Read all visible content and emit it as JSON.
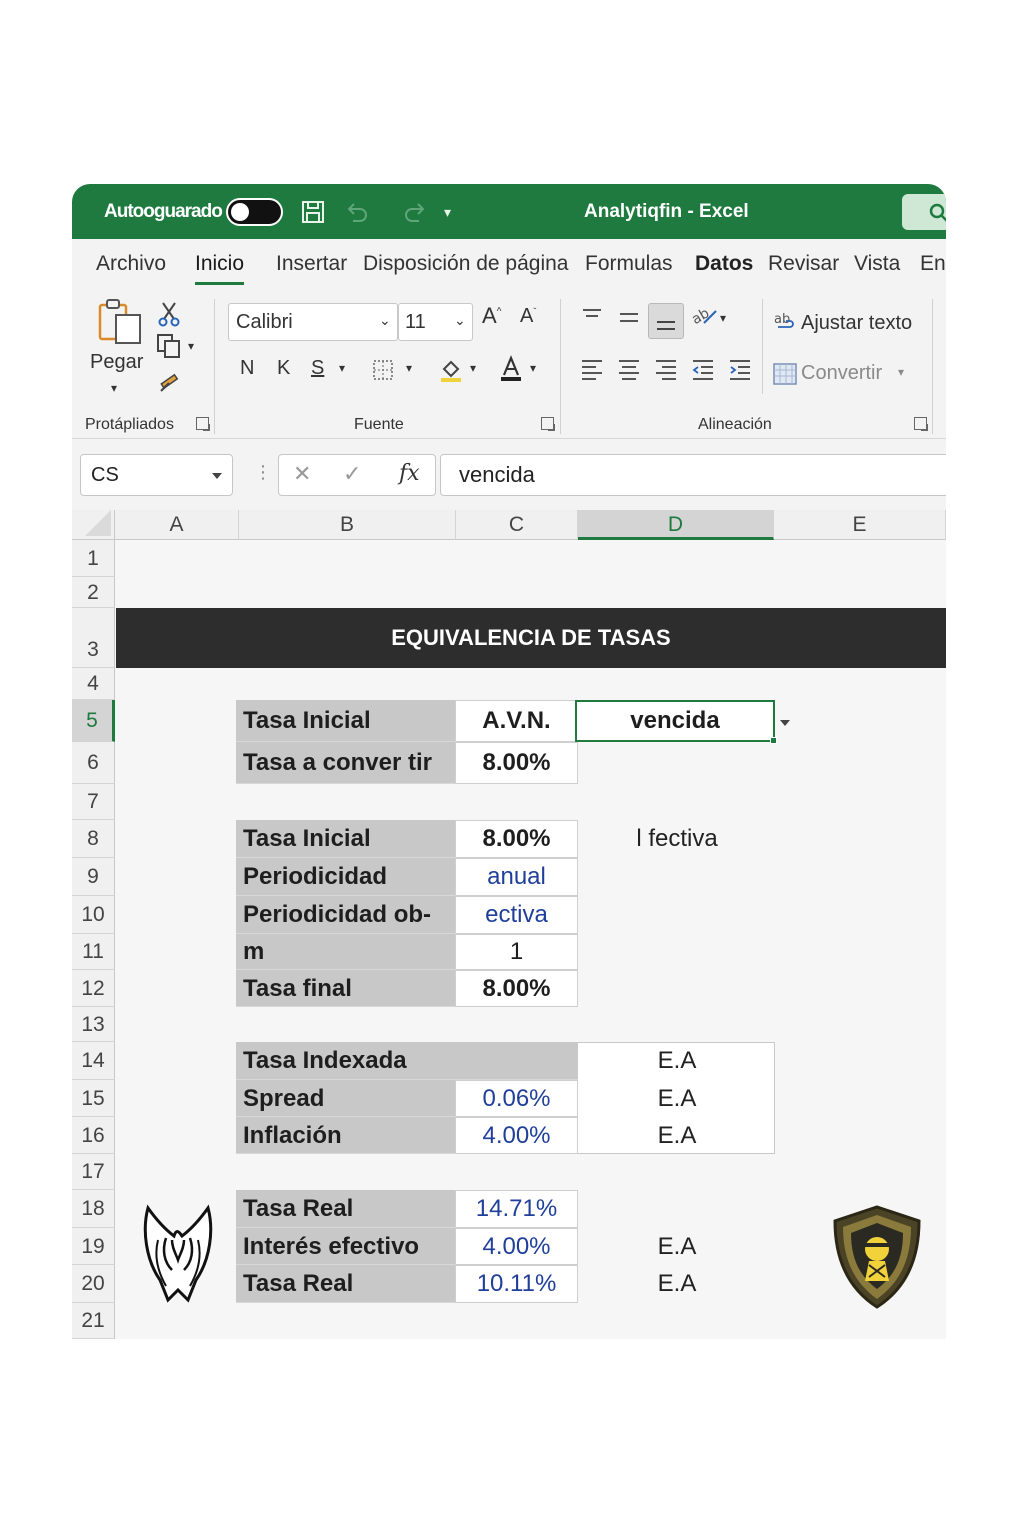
{
  "titlebar": {
    "autosave_label": "Autooguarado",
    "title": "Analytiqfin - Excel",
    "bg_color": "#1e7a3f"
  },
  "tabs": [
    {
      "label": "Archivo"
    },
    {
      "label": "Inicio"
    },
    {
      "label": "Insertar"
    },
    {
      "label": "Disposición de página"
    },
    {
      "label": "Formulas"
    },
    {
      "label": "Datos"
    },
    {
      "label": "Revisar"
    },
    {
      "label": "Vista"
    },
    {
      "label": "En"
    }
  ],
  "ribbon": {
    "clipboard": {
      "paste_label": "Pegar",
      "group_label": "Protápliados"
    },
    "font": {
      "font_name": "Calibri",
      "font_size": "11",
      "bold_label": "N",
      "italic_label": "K",
      "underline_label": "S",
      "group_label": "Fuente"
    },
    "alignment": {
      "wrap_label": "Ajustar texto",
      "merge_label": "Convertir",
      "group_label": "Alineación"
    }
  },
  "formula_bar": {
    "name_box": "CS",
    "fx_label": "fx",
    "value": "vencida"
  },
  "columns": [
    "A",
    "B",
    "C",
    "D",
    "E"
  ],
  "selected_column": "D",
  "rows": [
    "1",
    "2",
    "3",
    "4",
    "5",
    "6",
    "7",
    "8",
    "9",
    "10",
    "11",
    "12",
    "13",
    "14",
    "15",
    "16",
    "17",
    "18",
    "19",
    "20",
    "21"
  ],
  "selected_row": "5",
  "sheet": {
    "banner": "EQUIVALENCIA DE TASAS",
    "block1": {
      "r5_label": "Tasa Inicial",
      "r5_value": "A.V.N.",
      "r5_dropdown": "vencida",
      "r6_label": "Tasa a conver tir",
      "r6_value": "8.00%"
    },
    "block2": {
      "r8_label": "Tasa Inicial",
      "r8_value": "8.00%",
      "r8_note": "l fectiva",
      "r9_label": "Periodicidad",
      "r9_value": "anual",
      "r10_label": "Periodicidad ob-",
      "r10_value": "ectiva",
      "r11_label": "m",
      "r11_value": "1",
      "r12_label": "Tasa final",
      "r12_value": "8.00%"
    },
    "block3": {
      "r14_label": "Tasa Indexada",
      "r14_unit": "E.A",
      "r15_label": "Spread",
      "r15_value": "0.06%",
      "r15_unit": "E.A",
      "r16_label": "Inflación",
      "r16_value": "4.00%",
      "r16_unit": "E.A"
    },
    "block4": {
      "r18_label": "Tasa Real",
      "r18_value": "14.71%",
      "r19_label": "Interés efectivo",
      "r19_value": "4.00%",
      "r19_unit": "E.A",
      "r20_label": "Tasa Real",
      "r20_value": "10.11%",
      "r20_unit": "E.A"
    }
  },
  "colors": {
    "accent": "#1e7a3f",
    "label_fill": "#c8c8c8",
    "banner_fill": "#2d2d2d",
    "blue_value": "#1f3f9a"
  }
}
